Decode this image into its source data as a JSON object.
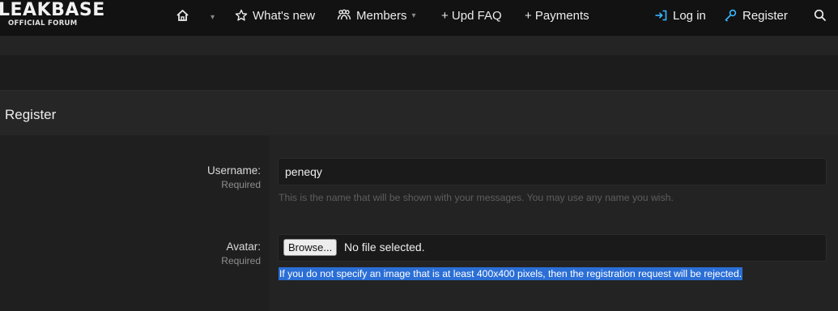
{
  "brand": {
    "name": "LEAKBASE",
    "tagline": "OFFICIAL FORUM"
  },
  "nav": {
    "home_icon": "home-icon",
    "home_caret": "▾",
    "whats_new": "What's new",
    "members": "Members",
    "members_caret": "▾",
    "upd_faq": "+ Upd FAQ",
    "payments": "+ Payments",
    "login": "Log in",
    "register": "Register",
    "search_icon": "search-icon"
  },
  "page": {
    "title": "Register"
  },
  "form": {
    "username": {
      "label": "Username:",
      "required": "Required",
      "value": "peneqy",
      "hint": "This is the name that will be shown with your messages. You may use any name you wish."
    },
    "avatar": {
      "label": "Avatar:",
      "required": "Required",
      "browse_label": "Browse...",
      "file_status": "No file selected.",
      "hint": "If you do not specify an image that is at least 400x400 pixels, then the registration request will be rejected."
    }
  },
  "colors": {
    "accent": "#39b7ff",
    "selection": "#2b6fd6",
    "navbar": "#121212",
    "background": "#1c1c1c"
  }
}
